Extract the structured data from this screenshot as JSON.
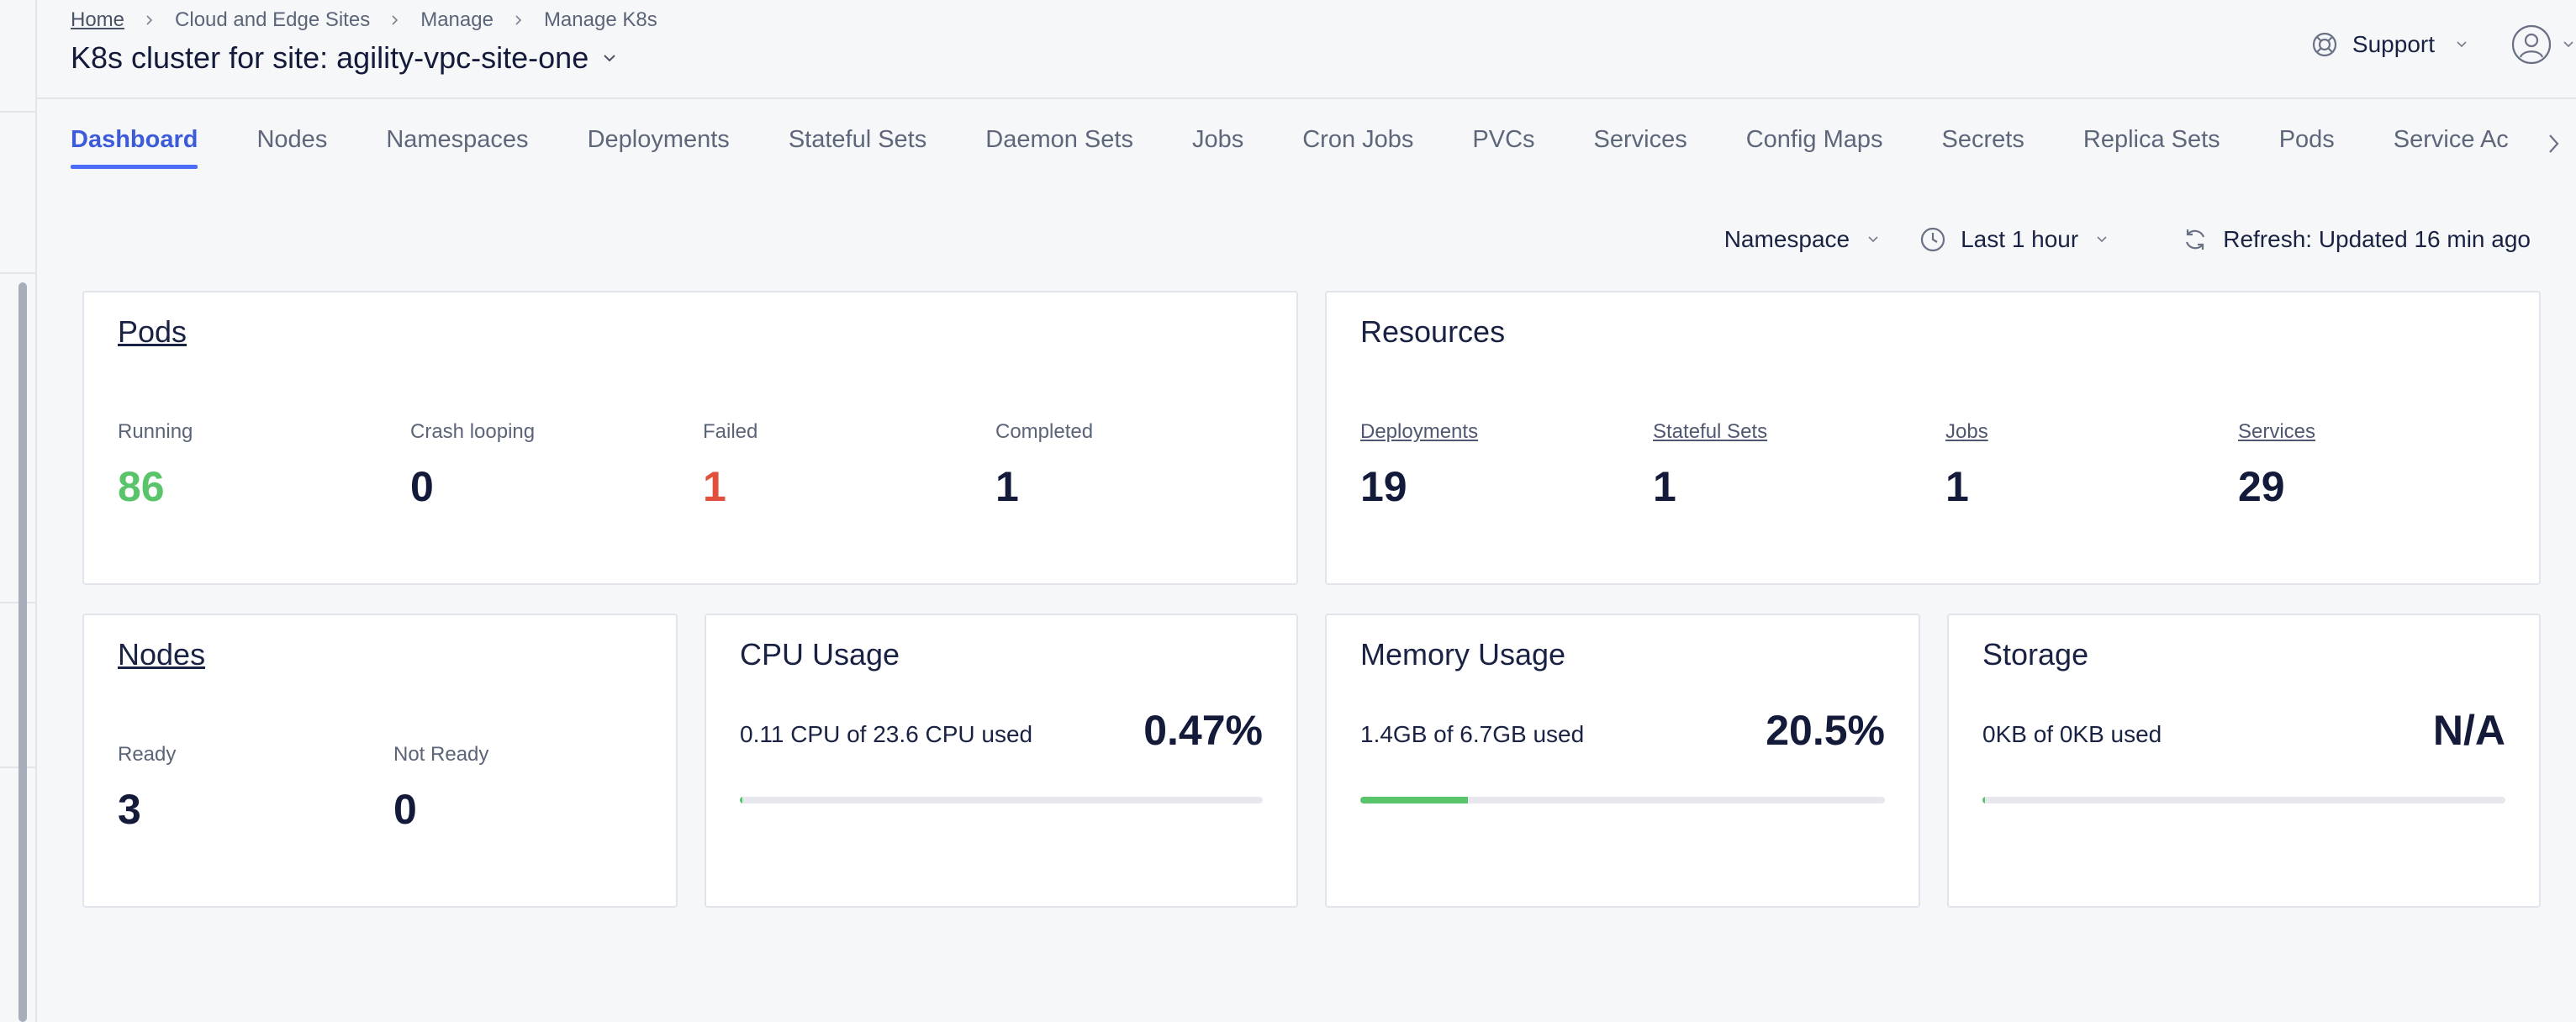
{
  "breadcrumb": [
    {
      "label": "Home",
      "link": true
    },
    {
      "label": "Cloud and Edge Sites",
      "link": false
    },
    {
      "label": "Manage",
      "link": false
    },
    {
      "label": "Manage K8s",
      "link": false
    }
  ],
  "page_title": "K8s cluster for site: agility-vpc-site-one",
  "header": {
    "support_label": "Support"
  },
  "tabs": [
    {
      "label": "Dashboard",
      "active": true
    },
    {
      "label": "Nodes"
    },
    {
      "label": "Namespaces"
    },
    {
      "label": "Deployments"
    },
    {
      "label": "Stateful Sets"
    },
    {
      "label": "Daemon Sets"
    },
    {
      "label": "Jobs"
    },
    {
      "label": "Cron Jobs"
    },
    {
      "label": "PVCs"
    },
    {
      "label": "Services"
    },
    {
      "label": "Config Maps"
    },
    {
      "label": "Secrets"
    },
    {
      "label": "Replica Sets"
    },
    {
      "label": "Pods"
    },
    {
      "label": "Service Ac"
    }
  ],
  "toolbar": {
    "namespace_label": "Namespace",
    "time_range_label": "Last 1 hour",
    "refresh_label": "Refresh: Updated 16 min ago"
  },
  "pods": {
    "title": "Pods",
    "stats": [
      {
        "label": "Running",
        "value": "86"
      },
      {
        "label": "Crash looping",
        "value": "0"
      },
      {
        "label": "Failed",
        "value": "1"
      },
      {
        "label": "Completed",
        "value": "1"
      }
    ]
  },
  "resources": {
    "title": "Resources",
    "stats": [
      {
        "label": "Deployments",
        "value": "19"
      },
      {
        "label": "Stateful Sets",
        "value": "1"
      },
      {
        "label": "Jobs",
        "value": "1"
      },
      {
        "label": "Services",
        "value": "29"
      }
    ]
  },
  "nodes": {
    "title": "Nodes",
    "stats": [
      {
        "label": "Ready",
        "value": "3"
      },
      {
        "label": "Not Ready",
        "value": "0"
      }
    ]
  },
  "cpu": {
    "title": "CPU Usage",
    "usage_text": "0.11 CPU of 23.6 CPU used",
    "percent_label": "0.47%",
    "fill_fraction": 0.0047
  },
  "memory": {
    "title": "Memory Usage",
    "usage_text": "1.4GB of 6.7GB used",
    "percent_label": "20.5%",
    "fill_fraction": 0.205
  },
  "storage": {
    "title": "Storage",
    "usage_text": "0KB of 0KB used",
    "percent_label": "N/A",
    "fill_fraction": 0
  },
  "colors": {
    "accent": "#4a6cf7",
    "running": "#5ac46a",
    "failed": "#e0503a",
    "bar_fill": "#5ac46a"
  }
}
